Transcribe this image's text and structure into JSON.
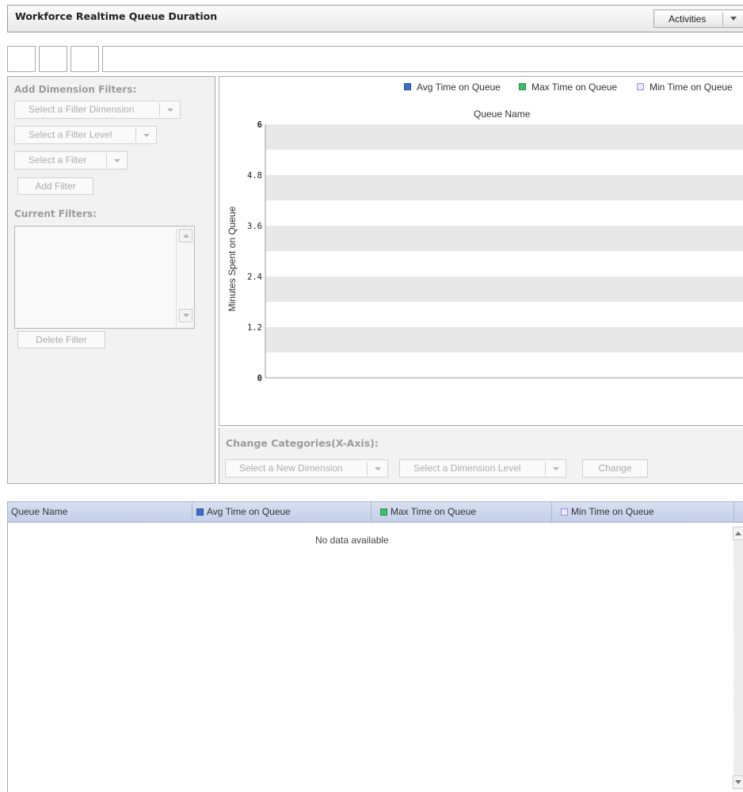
{
  "header": {
    "title": "Workforce Realtime Queue Duration",
    "activities_label": "Activities"
  },
  "filters": {
    "add_heading": "Add Dimension Filters:",
    "dimension_dropdown": "Select a Filter Dimension",
    "level_dropdown": "Select a Filter Level",
    "filter_dropdown": "Select a Filter",
    "add_button": "Add Filter",
    "current_heading": "Current Filters:",
    "delete_button": "Delete Filter"
  },
  "chart_data": {
    "type": "bar",
    "title": "Queue Name",
    "xlabel": "",
    "ylabel": "Minutes Spent on Queue",
    "ylim": [
      0,
      6
    ],
    "yticks": [
      "0",
      "1.2",
      "2.4",
      "3.6",
      "4.8",
      "6"
    ],
    "categories": [],
    "series": [
      {
        "name": "Avg Time on Queue",
        "color": "#3b6fc9",
        "values": []
      },
      {
        "name": "Max Time on Queue",
        "color": "#3fbf6a",
        "values": []
      },
      {
        "name": "Min Time on Queue",
        "color": "#b5a8e8",
        "values": []
      }
    ],
    "grid": true,
    "legend": "top-right"
  },
  "xaxis_panel": {
    "heading": "Change Categories(X-Axis):",
    "dimension_dropdown": "Select a New Dimension",
    "level_dropdown": "Select a Dimension Level",
    "change_button": "Change"
  },
  "grid": {
    "columns": [
      "Queue Name",
      "Avg Time on Queue",
      "Max Time on Queue",
      "Min Time on Queue"
    ],
    "empty_message": "No data available"
  },
  "colors": {
    "avg": "#3b6fc9",
    "max": "#3fbf6a",
    "min": "#b5a8e8",
    "header_bg": "#c4cfe8"
  }
}
